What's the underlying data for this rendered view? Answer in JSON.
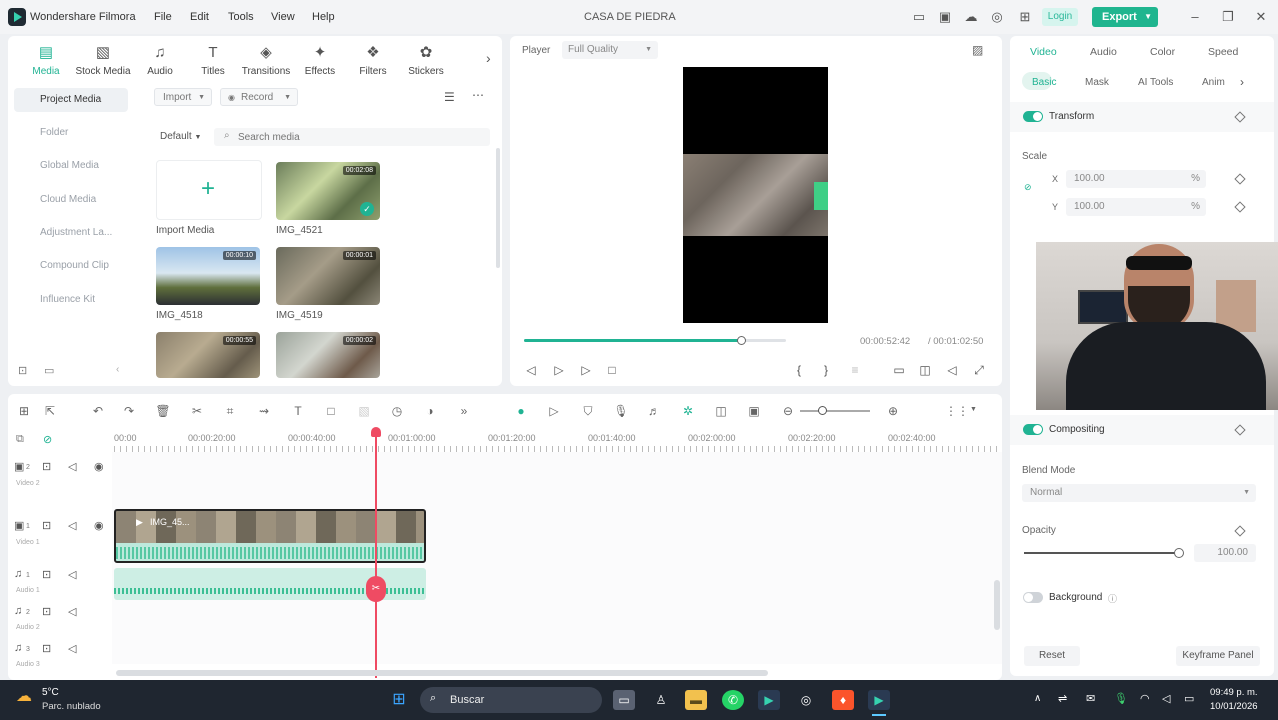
{
  "app": {
    "name": "Wondershare Filmora",
    "project_title": "CASA DE PIEDRA",
    "menu": [
      "File",
      "Edit",
      "Tools",
      "View",
      "Help"
    ],
    "login_label": "Login",
    "export_label": "Export"
  },
  "media_panel": {
    "tabs": [
      {
        "label": "Media",
        "icon": "media-icon"
      },
      {
        "label": "Stock Media",
        "icon": "stock-media-icon"
      },
      {
        "label": "Audio",
        "icon": "music-note-icon"
      },
      {
        "label": "Titles",
        "icon": "titles-icon"
      },
      {
        "label": "Transitions",
        "icon": "transitions-icon"
      },
      {
        "label": "Effects",
        "icon": "effects-icon"
      },
      {
        "label": "Filters",
        "icon": "filters-icon"
      },
      {
        "label": "Stickers",
        "icon": "stickers-icon"
      }
    ],
    "sidebar": [
      "Project Media",
      "Folder",
      "Global Media",
      "Cloud Media",
      "Adjustment La...",
      "Compound Clip",
      "Influence Kit"
    ],
    "import_label": "Import",
    "record_label": "Record",
    "sort_label": "Default",
    "search_placeholder": "Search media",
    "import_media_label": "Import Media",
    "items": [
      {
        "label": "IMG_4521",
        "duration": "00:02:08"
      },
      {
        "label": "IMG_4518",
        "duration": "00:00:10"
      },
      {
        "label": "IMG_4519",
        "duration": "00:00:01"
      },
      {
        "label": "",
        "duration": "00:00:55"
      },
      {
        "label": "",
        "duration": "00:00:02"
      }
    ]
  },
  "player": {
    "label": "Player",
    "quality": "Full Quality",
    "current_time": "00:00:52:42",
    "total_time": "/ 00:01:02:50",
    "progress": 0.83
  },
  "properties": {
    "tabs": [
      "Video",
      "Audio",
      "Color",
      "Speed"
    ],
    "subtabs": [
      "Basic",
      "Mask",
      "AI Tools",
      "Anim"
    ],
    "transform_label": "Transform",
    "scale_label": "Scale",
    "scale_x_label": "X",
    "scale_y_label": "Y",
    "scale_x": "100.00",
    "scale_y": "100.00",
    "percent": "%",
    "compositing_label": "Compositing",
    "blend_mode_label": "Blend Mode",
    "blend_mode_value": "Normal",
    "opacity_label": "Opacity",
    "opacity_value": "100.00",
    "background_label": "Background",
    "reset_label": "Reset",
    "keyframe_panel_label": "Keyframe Panel"
  },
  "timeline": {
    "ruler": [
      "00:00",
      "00:00:20:00",
      "00:00:40:00",
      "00:01:00:00",
      "00:01:20:00",
      "00:01:40:00",
      "00:02:00:00",
      "00:02:20:00",
      "00:02:40:00"
    ],
    "tracks": [
      {
        "name": "Video 2",
        "number": "2"
      },
      {
        "name": "Video 1",
        "number": "1"
      },
      {
        "name": "Audio 1",
        "number": "1"
      },
      {
        "name": "Audio 2",
        "number": "2"
      },
      {
        "name": "Audio 3",
        "number": "3"
      }
    ],
    "clip_label": "IMG_45..."
  },
  "taskbar": {
    "weather_temp": "5°C",
    "weather_desc": "Parc. nublado",
    "search_label": "Buscar",
    "time": "09:49 p. m.",
    "date": "10/01/2026"
  }
}
